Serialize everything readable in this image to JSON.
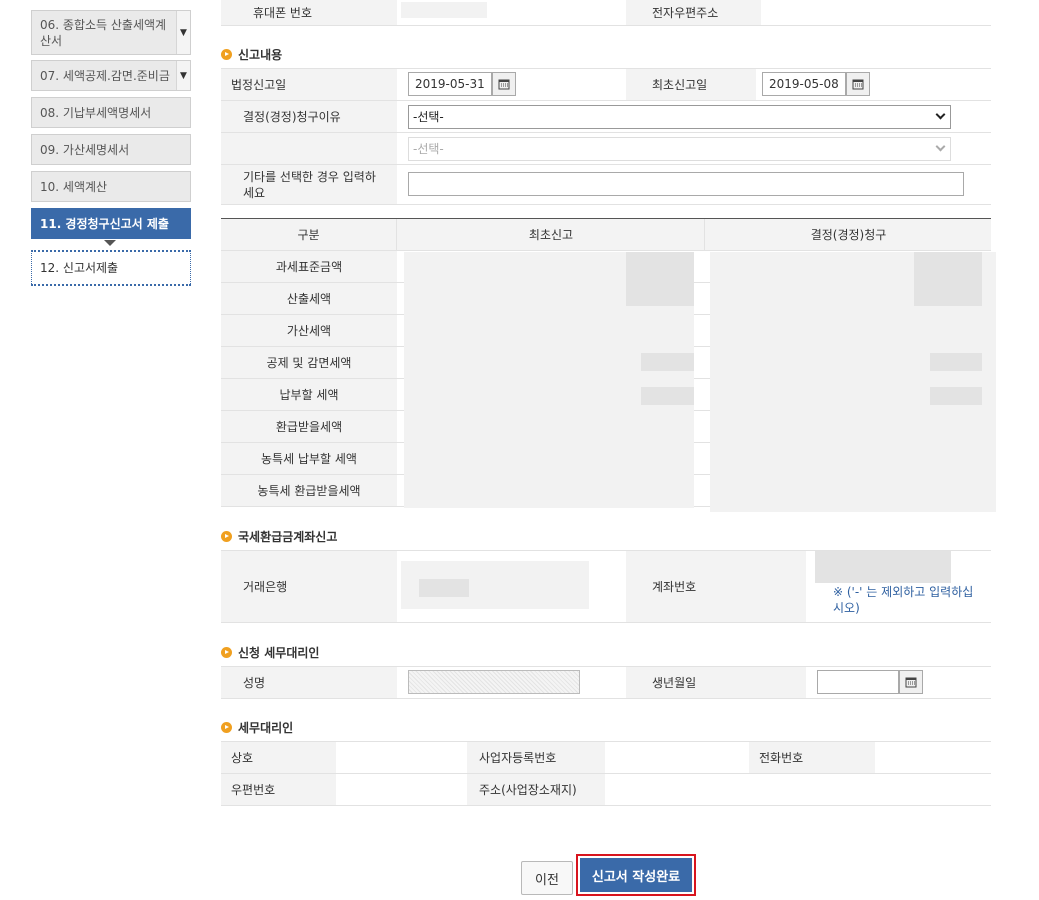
{
  "sidebar": {
    "items": [
      {
        "label": "06. 종합소득 산출세액계산서",
        "dropdown": true
      },
      {
        "label": "07. 세액공제.감면.준비금",
        "dropdown": true
      },
      {
        "label": "08. 기납부세액명세서"
      },
      {
        "label": "09. 가산세명세서"
      },
      {
        "label": "10. 세액계산"
      },
      {
        "label": "11. 경정청구신고서 제출",
        "state": "active"
      },
      {
        "label": "12. 신고서제출",
        "state": "current"
      }
    ]
  },
  "contact": {
    "phone_label": "휴대폰 번호",
    "email_label": "전자우편주소"
  },
  "report": {
    "section_title": "신고내용",
    "legal_date_label": "법정신고일",
    "legal_date_value": "2019-05-31",
    "first_date_label": "최초신고일",
    "first_date_value": "2019-05-08",
    "reason_label": "결정(경정)청구이유",
    "reason_selected": "-선택-",
    "sub_reason_selected": "-선택-",
    "other_label": "기타를 선택한 경우 입력하세요",
    "other_value": ""
  },
  "tax_table": {
    "headers": [
      "구분",
      "최초신고",
      "결정(경정)청구"
    ],
    "rows": [
      "과세표준금액",
      "산출세액",
      "가산세액",
      "공제 및 감면세액",
      "납부할 세액",
      "환급받을세액",
      "농특세 납부할 세액",
      "농특세 환급받을세액"
    ]
  },
  "refund_account": {
    "section_title": "국세환급금계좌신고",
    "bank_label": "거래은행",
    "account_label": "계좌번호",
    "account_note": "※ ('-' 는 제외하고 입력하십시오)"
  },
  "agent_apply": {
    "section_title": "신청 세무대리인",
    "name_label": "성명",
    "birth_label": "생년월일"
  },
  "agent": {
    "section_title": "세무대리인",
    "company_label": "상호",
    "bizno_label": "사업자등록번호",
    "phone_label": "전화번호",
    "zip_label": "우편번호",
    "address_label": "주소(사업장소재지)"
  },
  "buttons": {
    "prev": "이전",
    "complete": "신고서 작성완료"
  },
  "colors": {
    "accent": "#3a6aa9",
    "highlight_border": "#d8141e",
    "section_dot": "#f0a020"
  }
}
